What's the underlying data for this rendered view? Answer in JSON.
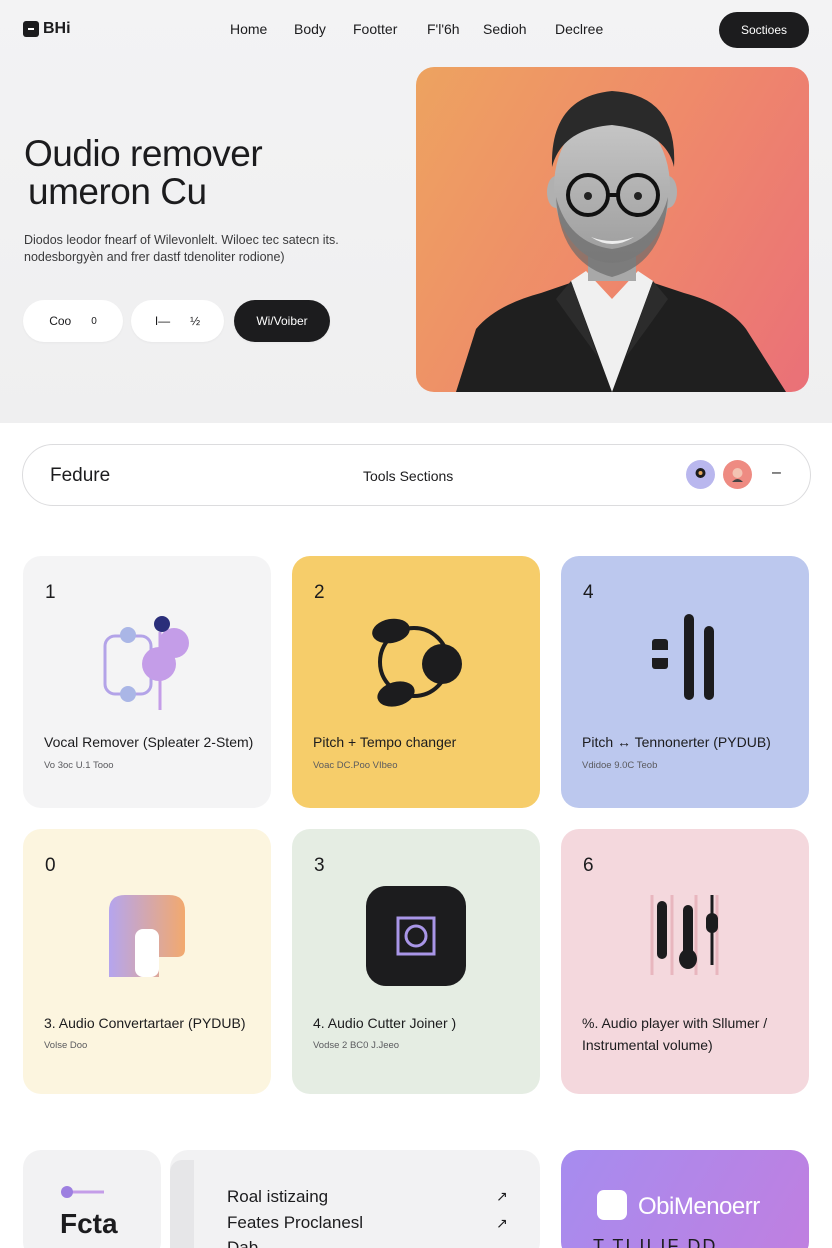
{
  "nav": {
    "brand": "BHi",
    "links": [
      "Home",
      "Body",
      "Footter",
      "F'l'6h",
      "Sedioh",
      "Declree"
    ],
    "cta": "Soctioes"
  },
  "hero": {
    "title_line1": "Oudio remover",
    "title_line2": "umeron Cu",
    "desc_line1": "Diodos leodor fnearf of Wilevonlelt. Wiloec tec satecn its.",
    "desc_line2": "nodesborgyèn and frer dastf tdenoliter rodione)",
    "btn1_a": "Coo",
    "btn1_b": "0",
    "btn2_a": "I—",
    "btn2_b": "½",
    "btn3": "Wi/Voiber"
  },
  "tools_bar": {
    "left": "Fedure",
    "center": "Tools Sections",
    "dash": "–"
  },
  "cards": [
    {
      "num": "1",
      "title": "Vocal Remover (Spleater 2-Stem)",
      "sub": "Vo 3oc U.1 Tooo",
      "bg": "#f4f4f5",
      "icon": "vocal-split-icon"
    },
    {
      "num": "2",
      "title": "Pitch + Tempo changer",
      "sub": "Voac DC.Poo VIbeo",
      "bg": "#f6cd6a",
      "icon": "pitch-knob-icon"
    },
    {
      "num": "4",
      "title": "Pitch ↔ Tennonerter (PYDUB)",
      "sub": "Vdidoe 9.0C Teob",
      "bg": "#bcc8ee",
      "icon": "sound-bars-icon"
    },
    {
      "num": "0",
      "title": "3. Audio Convertartaer (PYDUB)",
      "sub": "Volse Doo",
      "bg": "#fcf5df",
      "icon": "converter-icon"
    },
    {
      "num": "3",
      "title": "4. Audio Cutter Joiner )",
      "sub": "Vodse 2 BC0 J.Jeeo",
      "bg": "#e5ede3",
      "icon": "cutter-square-icon"
    },
    {
      "num": "6",
      "title": "%. Audio player with Sllumer / Instrumental volume)",
      "sub": "",
      "bg": "#f4d8dd",
      "icon": "mixer-sliders-icon"
    }
  ],
  "bottom": {
    "feature_title": "Fcta",
    "line1": "Roal istizaing",
    "line2": "Feates Proclanesl",
    "line3": "Dab",
    "arrow": "↗",
    "brand_name": "ObiMenoerr",
    "brand_sub": "T TI II IF DD"
  }
}
